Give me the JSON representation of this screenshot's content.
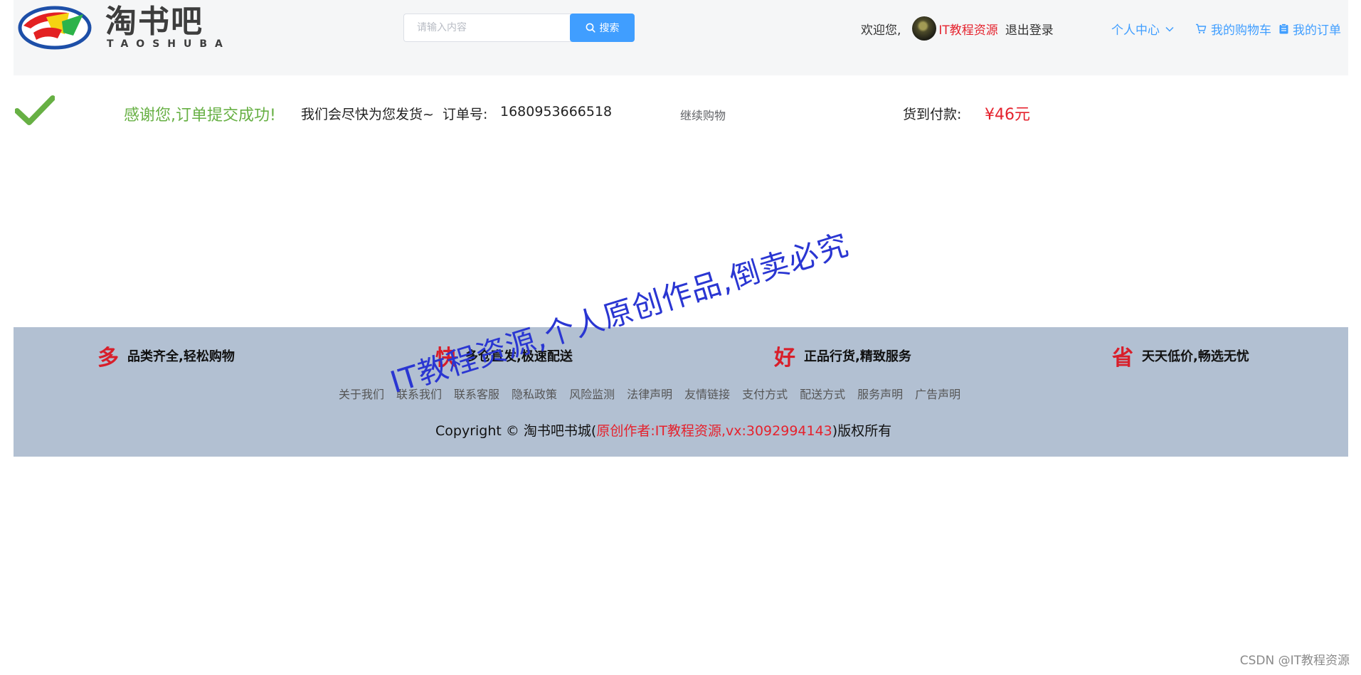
{
  "header": {
    "logo_cn": "淘书吧",
    "logo_en": "TAOSHUBA",
    "search": {
      "placeholder": "请输入内容",
      "button_label": "搜索"
    },
    "welcome_text": "欢迎您,",
    "username": "IT教程资源",
    "logout_label": "退出登录",
    "user_center_label": "个人中心",
    "cart_label": "我的购物车",
    "orders_label": "我的订单"
  },
  "success": {
    "thanks": "感谢您,订单提交成功!",
    "message": "我们会尽快为您发货~",
    "order_no_label": "订单号:",
    "order_no": "1680953666518",
    "continue_label": "继续购物",
    "cod_label": "货到付款:",
    "price": "¥46元"
  },
  "footer": {
    "features": [
      {
        "big": "多",
        "text": "品类齐全,轻松购物"
      },
      {
        "big": "快",
        "text": "多仓直发,极速配送"
      },
      {
        "big": "好",
        "text": "正品行货,精致服务"
      },
      {
        "big": "省",
        "text": "天天低价,畅选无忧"
      }
    ],
    "links": [
      "关于我们",
      "联系我们",
      "联系客服",
      "隐私政策",
      "风险监测",
      "法律声明",
      "友情链接",
      "支付方式",
      "配送方式",
      "服务声明",
      "广告声明"
    ],
    "copyright_prefix": "Copyright © 淘书吧书城(",
    "copyright_highlight": "原创作者:IT教程资源,vx:3092994143",
    "copyright_suffix": ")版权所有"
  },
  "watermark": "IT教程资源,个人原创作品,倒卖必究",
  "csdn_mark": "CSDN @IT教程资源",
  "colors": {
    "accent": "#409eff",
    "success": "#67b044",
    "price": "#e5222d",
    "footer_bg": "#b2c0d2",
    "header_bg": "#f5f6f7"
  }
}
